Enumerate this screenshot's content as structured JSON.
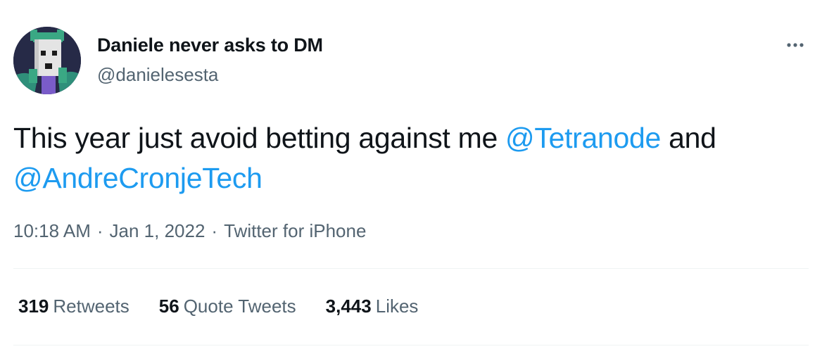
{
  "author": {
    "display_name": "Daniele never asks to DM",
    "handle": "@danielesesta",
    "avatar_icon": "robot-avatar-icon"
  },
  "more_icon": "more-horizontal-icon",
  "tweet": {
    "text_before": "This year just avoid betting against me ",
    "mention_1": "@Tetranode",
    "text_middle": " and ",
    "mention_2": "@AndreCronjeTech"
  },
  "meta": {
    "time": "10:18 AM",
    "separator": "·",
    "date": "Jan 1, 2022",
    "source": "Twitter for iPhone"
  },
  "stats": {
    "retweets_count": "319",
    "retweets_label": "Retweets",
    "quote_tweets_count": "56",
    "quote_tweets_label": "Quote Tweets",
    "likes_count": "3,443",
    "likes_label": "Likes"
  },
  "colors": {
    "text": "#0f1419",
    "secondary": "#536471",
    "link": "#1d9bf0",
    "divider": "#eff3f4"
  }
}
